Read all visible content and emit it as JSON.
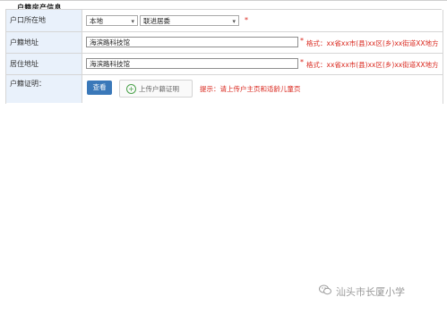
{
  "section": {
    "title": "户籍房产信息"
  },
  "rows": {
    "residence": {
      "label": "户口所在地",
      "select1": "本地",
      "select2": "联进居委",
      "required": "*"
    },
    "household_address": {
      "label": "户籍地址",
      "value": "海滨路科技馆",
      "required": "*",
      "hint": "格式：xx省xx市(县)xx区(乡)xx街道XX地方"
    },
    "living_address": {
      "label": "居住地址",
      "value": "海滨路科技馆",
      "required": "*",
      "hint": "格式：xx省xx市(县)xx区(乡)xx街道XX地方"
    },
    "proof": {
      "label": "户籍证明：",
      "view_button": "查看",
      "upload_button": "上传户籍证明",
      "hint": "提示：请上传户主页和适龄儿童页"
    }
  },
  "watermark": {
    "text": "汕头市长厦小学",
    "icon": "wechat-icon"
  },
  "colors": {
    "accent": "#3a78b9",
    "label_bg": "#e9f1fb",
    "hint": "#d9261c"
  }
}
